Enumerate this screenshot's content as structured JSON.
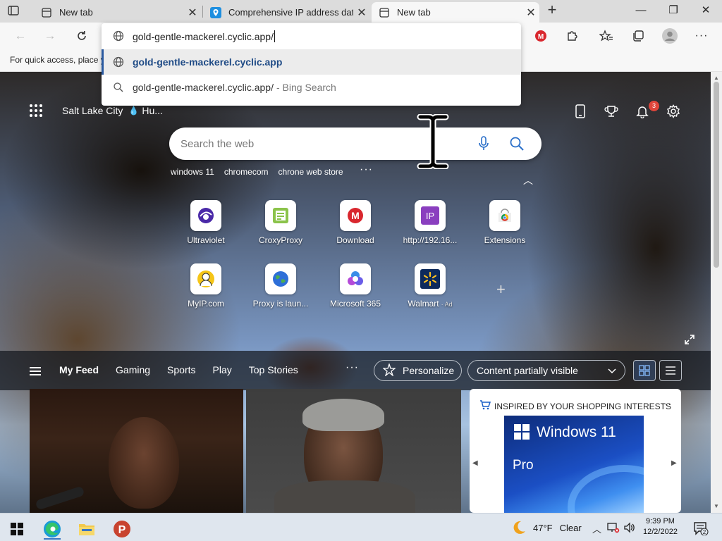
{
  "tabs": [
    {
      "title": "New tab",
      "favicon": "newtab-icon"
    },
    {
      "title": "Comprehensive IP address data,",
      "favicon": "ip-shield-icon"
    },
    {
      "title": "New tab",
      "favicon": "newtab-icon",
      "active": true
    }
  ],
  "window": {
    "minimize": "—",
    "maximize": "❐",
    "close": "✕"
  },
  "omnibox": {
    "value": "gold-gentle-mackerel.cyclic.app/",
    "suggestions": [
      {
        "text": "gold-gentle-mackerel.cyclic.app",
        "suffix": "",
        "icon": "globe-icon",
        "selected": true
      },
      {
        "text": "gold-gentle-mackerel.cyclic.app/",
        "suffix": "- Bing Search",
        "icon": "search-icon",
        "selected": false
      }
    ]
  },
  "favbar": {
    "text": "For quick access, place y"
  },
  "ntp": {
    "location": "Salt Lake City",
    "weather_short": "Hu...",
    "notification_count": "3",
    "search_placeholder": "Search the web",
    "trending": [
      "windows 11",
      "chromecom",
      "chrone web store"
    ],
    "more_dots": "···",
    "tiles_row1": [
      {
        "label": "Ultraviolet",
        "icon": "ultraviolet-icon"
      },
      {
        "label": "CroxyProxy",
        "icon": "croxyproxy-icon"
      },
      {
        "label": "Download",
        "icon": "mega-icon"
      },
      {
        "label": "http://192.16...",
        "icon": "ip-icon"
      },
      {
        "label": "Extensions",
        "icon": "chrome-webstore-icon"
      }
    ],
    "tiles_row2": [
      {
        "label": "MyIP.com",
        "icon": "myip-icon"
      },
      {
        "label": "Proxy is laun...",
        "icon": "proxy-globe-icon"
      },
      {
        "label": "Microsoft 365",
        "icon": "microsoft365-icon"
      },
      {
        "label": "Walmart",
        "ad": "· Ad",
        "icon": "walmart-icon"
      }
    ],
    "feed_tabs": [
      "My Feed",
      "Gaming",
      "Sports",
      "Play",
      "Top Stories"
    ],
    "personalize": "Personalize",
    "content_visibility": "Content partially visible",
    "shopping": {
      "heading": "INSPIRED BY YOUR SHOPPING INTERESTS",
      "product_title": "Windows 11",
      "product_sub": "Pro"
    }
  },
  "taskbar": {
    "temperature": "47°F",
    "condition": "Clear",
    "time": "9:39 PM",
    "date": "12/2/2022",
    "notifications": "2"
  },
  "colors": {
    "accent": "#2a5aa0",
    "badge": "#e0453a",
    "mega_red": "#d9272e",
    "ip_purple": "#8a3fbf"
  }
}
